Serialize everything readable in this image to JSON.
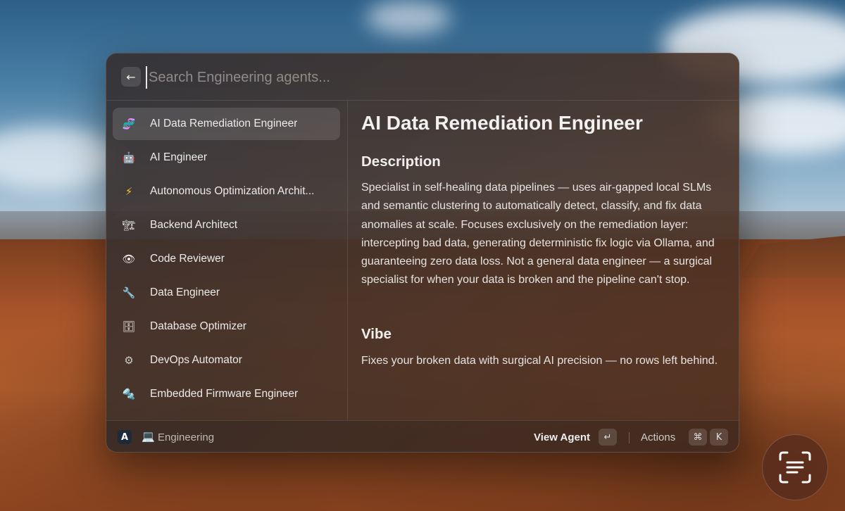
{
  "search": {
    "placeholder": "Search Engineering agents...",
    "value": ""
  },
  "agents": [
    {
      "label": "AI Data Remediation Engineer",
      "icon": "dna-icon",
      "glyph": "🧬",
      "selected": true
    },
    {
      "label": "AI Engineer",
      "icon": "robot-icon",
      "glyph": "🤖",
      "selected": false
    },
    {
      "label": "Autonomous Optimization Archit...",
      "icon": "lightning-icon",
      "glyph": "⚡",
      "selected": false
    },
    {
      "label": "Backend Architect",
      "icon": "crane-icon",
      "glyph": "🏗",
      "selected": false
    },
    {
      "label": "Code Reviewer",
      "icon": "eye-icon",
      "glyph": "👁",
      "selected": false
    },
    {
      "label": "Data Engineer",
      "icon": "wrench-icon",
      "glyph": "🔧",
      "selected": false
    },
    {
      "label": "Database Optimizer",
      "icon": "cabinet-icon",
      "glyph": "🗄",
      "selected": false
    },
    {
      "label": "DevOps Automator",
      "icon": "gear-icon",
      "glyph": "⚙",
      "selected": false
    },
    {
      "label": "Embedded Firmware Engineer",
      "icon": "nut-bolt-icon",
      "glyph": "🔩",
      "selected": false
    }
  ],
  "detail": {
    "title": "AI Data Remediation Engineer",
    "description_heading": "Description",
    "description": "Specialist in self-healing data pipelines — uses air-gapped local SLMs and semantic clustering to automatically detect, classify, and fix data anomalies at scale. Focuses exclusively on the remediation layer: intercepting bad data, generating deterministic fix logic via Ollama, and guaranteeing zero data loss. Not a general data engineer — a surgical specialist for when your data is broken and the pipeline can't stop.",
    "vibe_heading": "Vibe",
    "vibe": "Fixes your broken data with surgical AI precision — no rows left behind."
  },
  "footer": {
    "logo": "A",
    "breadcrumb": "Engineering",
    "view_agent": "View Agent",
    "enter_key": "↵",
    "actions": "Actions",
    "cmd_key": "⌘",
    "k_key": "K"
  },
  "colors": {
    "accent_text": "#ecebea",
    "selected_bg": "rgba(255,255,255,0.12)"
  }
}
